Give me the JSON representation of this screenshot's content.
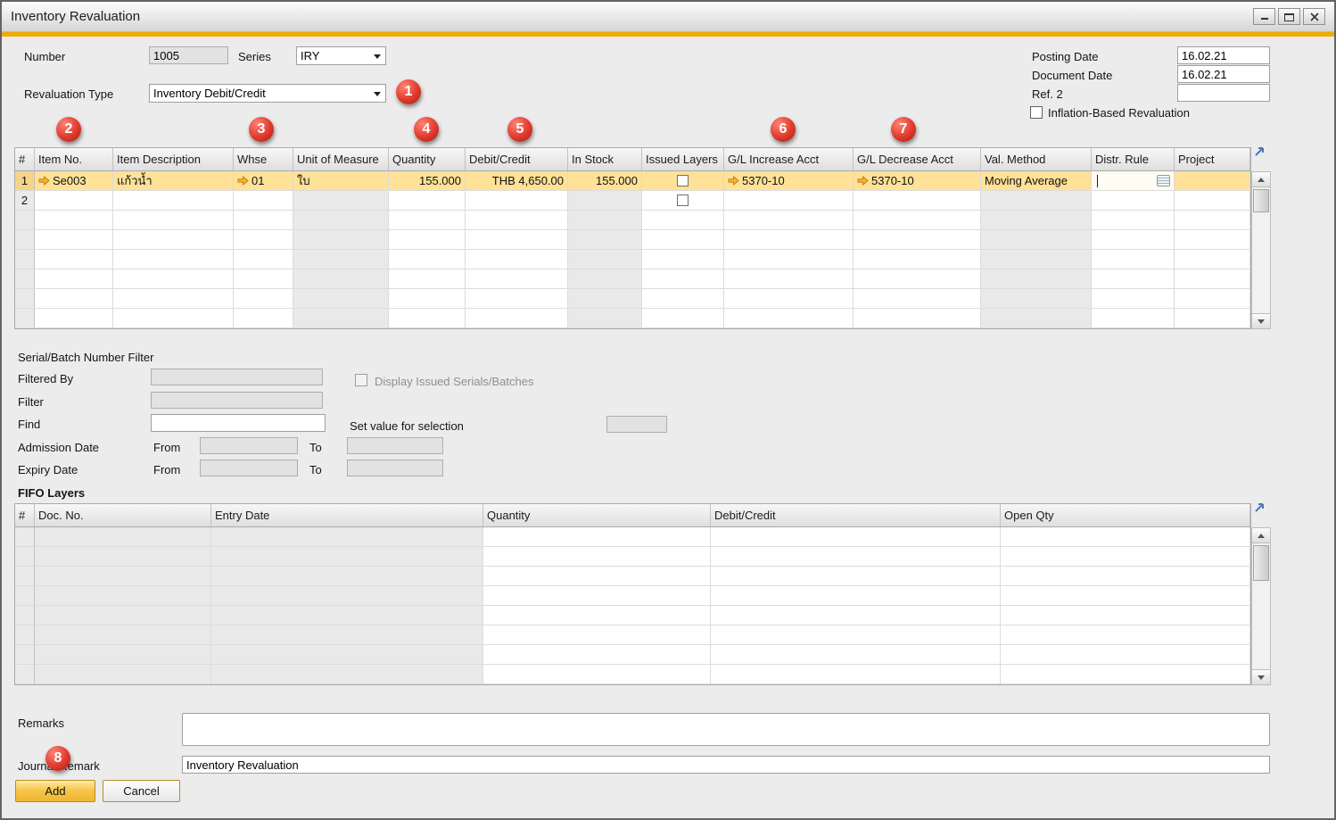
{
  "window": {
    "title": "Inventory Revaluation"
  },
  "form": {
    "number_label": "Number",
    "number_value": "1005",
    "series_label": "Series",
    "series_value": "IRY",
    "revaluation_type_label": "Revaluation Type",
    "revaluation_type_value": "Inventory Debit/Credit",
    "posting_date_label": "Posting Date",
    "posting_date_value": "16.02.21",
    "document_date_label": "Document Date",
    "document_date_value": "16.02.21",
    "ref2_label": "Ref. 2",
    "ref2_value": "",
    "inflation_checkbox_label": "Inflation-Based Revaluation"
  },
  "badges": [
    "1",
    "2",
    "3",
    "4",
    "5",
    "6",
    "7",
    "8"
  ],
  "items_table": {
    "columns": [
      "#",
      "Item No.",
      "Item Description",
      "Whse",
      "Unit of Measure",
      "Quantity",
      "Debit/Credit",
      "In Stock",
      "Issued Layers",
      "G/L Increase Acct",
      "G/L Decrease Acct",
      "Val. Method",
      "Distr. Rule",
      "Project"
    ],
    "visible_row_count": 8,
    "rows": [
      {
        "num": "1",
        "selected": true,
        "has_checkbox": true,
        "item_no": "Se003",
        "description": "แก้วน้ำ",
        "whse": "01",
        "uom": "ใบ",
        "quantity": "155.000",
        "debit_credit": "THB 4,650.00",
        "in_stock": "155.000",
        "gl_increase": "5370-10",
        "gl_decrease": "5370-10",
        "val_method": "Moving Average",
        "distr_rule": "",
        "project": ""
      },
      {
        "num": "2",
        "has_checkbox": true
      }
    ]
  },
  "serial_batch_filter": {
    "section_title": "Serial/Batch Number Filter",
    "filtered_by_label": "Filtered By",
    "filter_label": "Filter",
    "find_label": "Find",
    "display_issued_label": "Display Issued Serials/Batches",
    "set_value_label": "Set value for selection",
    "admission_date_label": "Admission Date",
    "expiry_date_label": "Expiry Date",
    "from_label": "From",
    "to_label": "To"
  },
  "fifo_layers": {
    "section_title": "FIFO Layers",
    "columns": [
      "#",
      "Doc. No.",
      "Entry Date",
      "Quantity",
      "Debit/Credit",
      "Open Qty"
    ],
    "visible_row_count": 8,
    "rows": []
  },
  "footer": {
    "remarks_label": "Remarks",
    "remarks_value": "",
    "journal_remark_label": "Journal Remark",
    "journal_remark_value": "Inventory Revaluation",
    "add_button": "Add",
    "cancel_button": "Cancel"
  },
  "colors": {
    "accent_gold": "#f0ab00",
    "selected_row_yellow": "#ffe198",
    "badge_red": "#d7281d",
    "link_arrow_orange": "#f9b233"
  }
}
